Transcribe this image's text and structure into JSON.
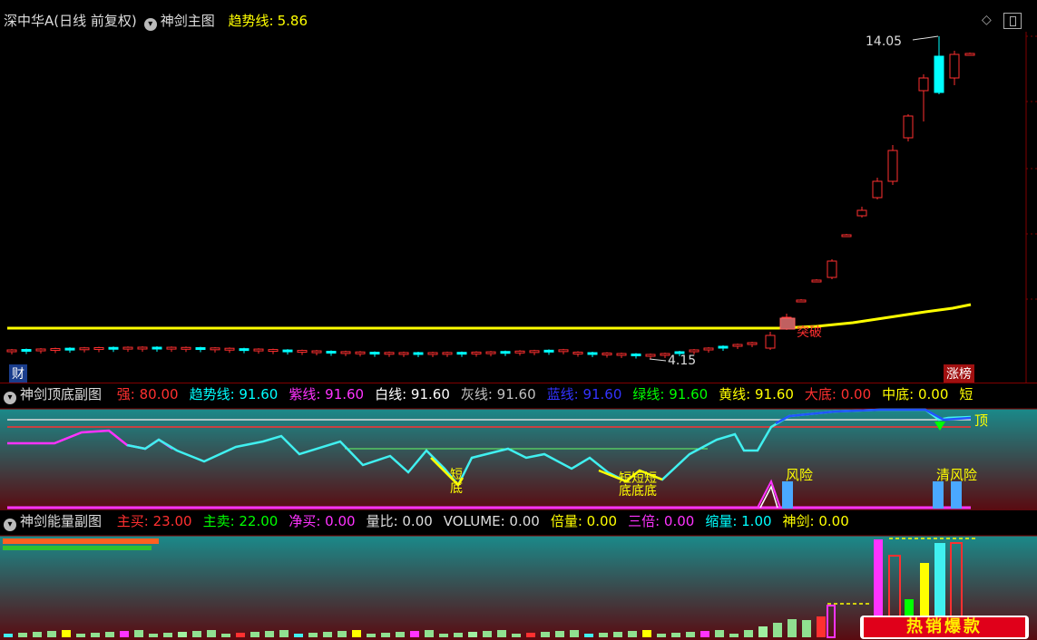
{
  "main_panel": {
    "stock_name": "深中华A(日线 前复权)",
    "indicator_name": "神剑主图",
    "trend_label": "趋势线:",
    "trend_value": "5.86",
    "high_label": "14.05",
    "low_label": "4.15",
    "breakout_label": "突破",
    "finance_tag": "财",
    "limit_up_tag": "涨榜",
    "colors": {
      "trend": "#ffff00",
      "up": "#ff3030",
      "down": "#00ffff"
    }
  },
  "sub1": {
    "title": "神剑顶底副图",
    "fields": [
      {
        "label": "强:",
        "value": "80.00",
        "color": "#ff3030"
      },
      {
        "label": "趋势线:",
        "value": "91.60",
        "color": "#00ffff"
      },
      {
        "label": "紫线:",
        "value": "91.60",
        "color": "#ff33ff"
      },
      {
        "label": "白线:",
        "value": "91.60",
        "color": "#ffffff"
      },
      {
        "label": "灰线:",
        "value": "91.60",
        "color": "#c0c0c0"
      },
      {
        "label": "蓝线:",
        "value": "91.60",
        "color": "#3333ff"
      },
      {
        "label": "绿线:",
        "value": "91.60",
        "color": "#00ff00"
      },
      {
        "label": "黄线:",
        "value": "91.60",
        "color": "#ffff00"
      },
      {
        "label": "大底:",
        "value": "0.00",
        "color": "#ff3030"
      },
      {
        "label": "中底:",
        "value": "0.00",
        "color": "#ffff00"
      },
      {
        "label": "短",
        "value": "",
        "color": "#ffff00"
      }
    ],
    "labels": {
      "top": "顶",
      "risk1": "风险",
      "risk2": "清风险",
      "bottom1": "短底",
      "bottom2": "短短短",
      "bottom2b": "底底底"
    }
  },
  "sub2": {
    "title": "神剑能量副图",
    "fields": [
      {
        "label": "主买:",
        "value": "23.00",
        "color": "#ff3030"
      },
      {
        "label": "主卖:",
        "value": "22.00",
        "color": "#00ff00"
      },
      {
        "label": "净买:",
        "value": "0.00",
        "color": "#ff33ff"
      },
      {
        "label": "量比:",
        "value": "0.00",
        "color": "#dddddd"
      },
      {
        "label": "VOLUME:",
        "value": "0.00",
        "color": "#dddddd"
      },
      {
        "label": "倍量:",
        "value": "0.00",
        "color": "#ffff00"
      },
      {
        "label": "三倍:",
        "value": "0.00",
        "color": "#ff33ff"
      },
      {
        "label": "缩量:",
        "value": "1.00",
        "color": "#00ffff"
      },
      {
        "label": "神剑:",
        "value": "0.00",
        "color": "#ffff00"
      }
    ],
    "promo_banner": "热销爆款"
  }
}
